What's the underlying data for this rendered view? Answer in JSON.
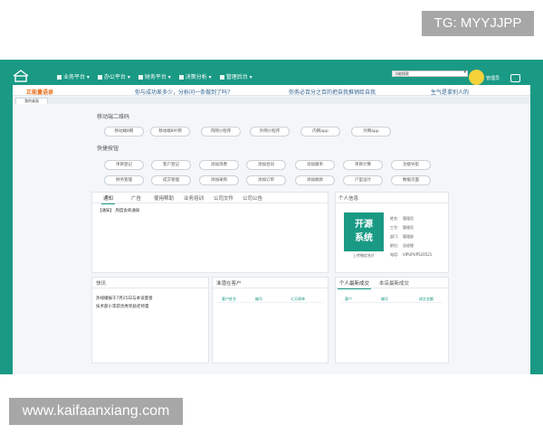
{
  "watermarks": {
    "top": "TG: MYYJJPP",
    "bottom": "www.kaifaanxiang.com"
  },
  "nav": {
    "menu": [
      {
        "label": "业务平台 ▾",
        "icon": "grid-icon"
      },
      {
        "label": "办公平台 ▾",
        "icon": "briefcase-icon"
      },
      {
        "label": "财务平台 ▾",
        "icon": "money-icon"
      },
      {
        "label": "决策分析 ▾",
        "icon": "chart-icon"
      },
      {
        "label": "管理后台 ▾",
        "icon": "settings-icon"
      }
    ],
    "select_value": "功能搜索",
    "user_name": "管理员",
    "colors": {
      "primary": "#1a9a85",
      "accent_orange": "#e96f1a",
      "avatar": "#f5d23a"
    }
  },
  "notice": {
    "label": "正能量语录",
    "items": [
      "你与成功差多少，分析问一条做到了吗?",
      "你务必百分之百的把自我推销给自我",
      "生气是拿别人的"
    ]
  },
  "tab": {
    "label": "我的桌面"
  },
  "qr": {
    "title": "移动端二维码",
    "buttons": [
      "移动端8网",
      "移动端8片网",
      "内网小程序",
      "外网小程序",
      "内网app",
      "外网app"
    ]
  },
  "quick": {
    "title": "快捷按钮",
    "row1": [
      "项目登记",
      "客户登记",
      "添加消费",
      "添加合同",
      "添加跟单",
      "项目计算",
      "功能导航"
    ],
    "row2": [
      "财务管理",
      "成交管理",
      "添加采购",
      "添加订单",
      "添加收款",
      "户型设计",
      "数据页面"
    ]
  },
  "announce": {
    "tabs": [
      "通知",
      "广告",
      "使用帮助",
      "业务培训",
      "公司文件",
      "公司公告"
    ],
    "item": "【通知】 周度会商通知"
  },
  "profile": {
    "title": "个人信息",
    "logo_line1": "开源",
    "logo_line2": "系统",
    "caption": "上传微信名片",
    "rows": [
      {
        "k": "姓名:",
        "v": "管理员"
      },
      {
        "k": "工号:",
        "v": "管理员"
      },
      {
        "k": "部门:",
        "v": "管理部"
      },
      {
        "k": "职位:",
        "v": "总经理"
      },
      {
        "k": "电话:",
        "v": "VIPUPUP520521"
      }
    ]
  },
  "news": {
    "title": "快讯",
    "items": [
      "热线播报于7月25日与本谈量香",
      "技术部小李获优秀奖励老师量"
    ]
  },
  "customers": {
    "title": "准潜在客户",
    "columns": [
      "客户姓名",
      "编号",
      "七天周单"
    ]
  },
  "deals": {
    "tabs": [
      "个人最新成交",
      "本店最新成交"
    ],
    "columns": [
      "客户",
      "编号",
      "成交金额"
    ]
  }
}
